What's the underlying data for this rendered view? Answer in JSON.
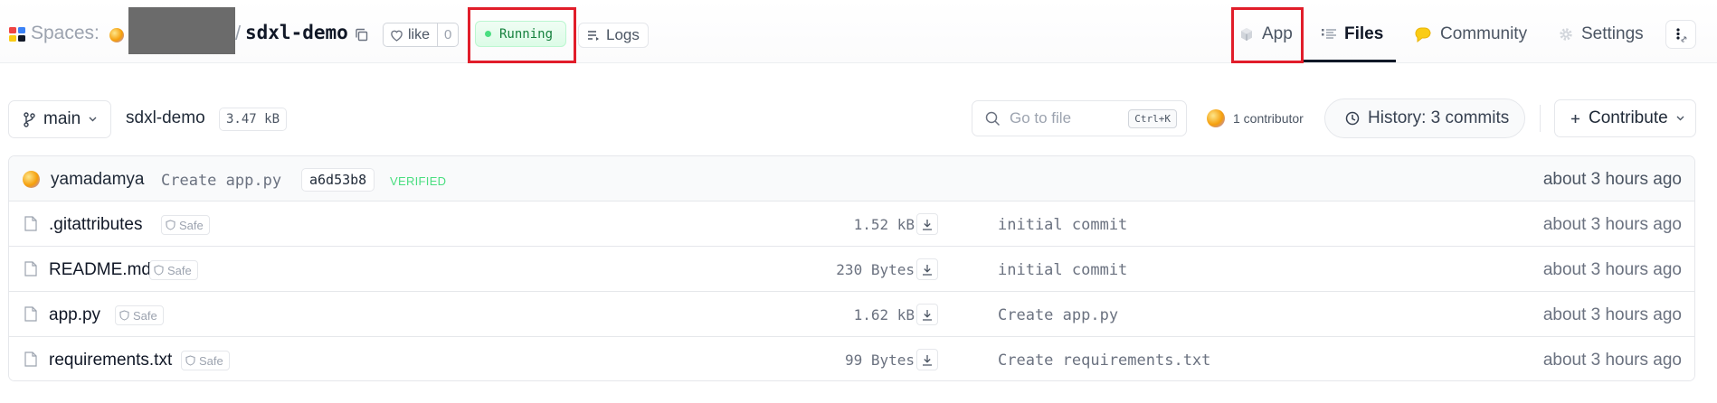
{
  "header": {
    "spaces_label": "Spaces:",
    "slash": "/",
    "repo_name": "sdxl-demo",
    "like_label": "like",
    "like_count": "0",
    "status": "Running",
    "logs_label": "Logs",
    "nav": {
      "app": "App",
      "files": "Files",
      "community": "Community",
      "settings": "Settings"
    },
    "colors": {
      "status_green": "#15803d",
      "highlight_red": "#e11d2a"
    }
  },
  "toolbar": {
    "branch": "main",
    "path": "sdxl-demo",
    "size": "3.47 kB",
    "search_placeholder": "Go to file",
    "search_shortcut": "Ctrl+K",
    "contributors": "1 contributor",
    "history": "History: 3 commits",
    "contribute": "Contribute"
  },
  "last_commit": {
    "user": "yamadamya",
    "message": "Create app.py",
    "hash": "a6d53b8",
    "verified": "VERIFIED",
    "time": "about 3 hours ago"
  },
  "files": [
    {
      "name": ".gitattributes",
      "badge": "Safe",
      "size": "1.52 kB",
      "message": "initial commit",
      "time": "about 3 hours ago"
    },
    {
      "name": "README.md",
      "badge": "Safe",
      "size": "230 Bytes",
      "message": "initial commit",
      "time": "about 3 hours ago"
    },
    {
      "name": "app.py",
      "badge": "Safe",
      "size": "1.62 kB",
      "message": "Create app.py",
      "time": "about 3 hours ago"
    },
    {
      "name": "requirements.txt",
      "badge": "Safe",
      "size": "99 Bytes",
      "message": "Create requirements.txt",
      "time": "about 3 hours ago"
    }
  ]
}
